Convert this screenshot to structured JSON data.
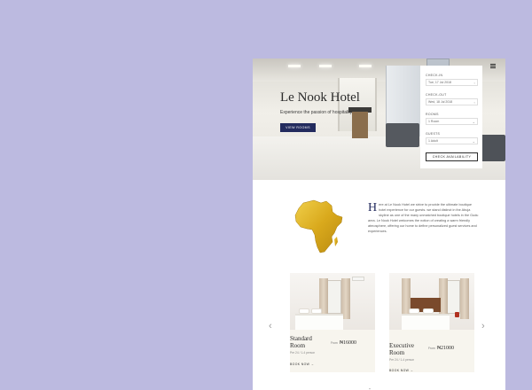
{
  "hero": {
    "title": "Le Nook Hotel",
    "subtitle": "Experience the passion of hospitality",
    "button_label": "VIEW ROOMS"
  },
  "booking": {
    "checkin_label": "CHECK-IN",
    "checkin_value": "Tue, 17 Jul 2018",
    "checkout_label": "CHECK-OUT",
    "checkout_value": "Wed, 18 Jul 2018",
    "rooms_label": "ROOMS",
    "rooms_value": "1 Room",
    "guests_label": "GUESTS",
    "guests_value": "1 Adult",
    "button_label": "CHECK AVAILABILITY",
    "calendar_icon": "calendar-icon",
    "dropdown_icon": "chevron-down-icon"
  },
  "about": {
    "drop_cap": "H",
    "text": "ere at Le Nook Hotel we strive to provide the ultimate boutique hotel experience for our guests. we stand distinct in the Abuja skyline as one of the many unmatched boutique hotels in the Gudu area. Le Nook Hotel welcomes the notion of creating a warm friendly atmosphere, offering our home to define personalized guest services and experiences."
  },
  "rooms": [
    {
      "title_line1": "Standard",
      "title_line2": "Room",
      "price_prefix": "From",
      "price": "₦16000",
      "per": "Per 24 / 1-4 person",
      "link": "BOOK NOW →"
    },
    {
      "title_line1": "Executive",
      "title_line2": "Room",
      "price_prefix": "From",
      "price": "₦21000",
      "per": "Per 24 / 1-4 person",
      "link": "BOOK NOW →"
    }
  ],
  "carousel": {
    "prev_icon": "chevron-left-icon",
    "next_icon": "chevron-right-icon"
  },
  "colors": {
    "background": "#bcbae0",
    "accent": "#232b5e",
    "card": "#f7f5ee"
  }
}
